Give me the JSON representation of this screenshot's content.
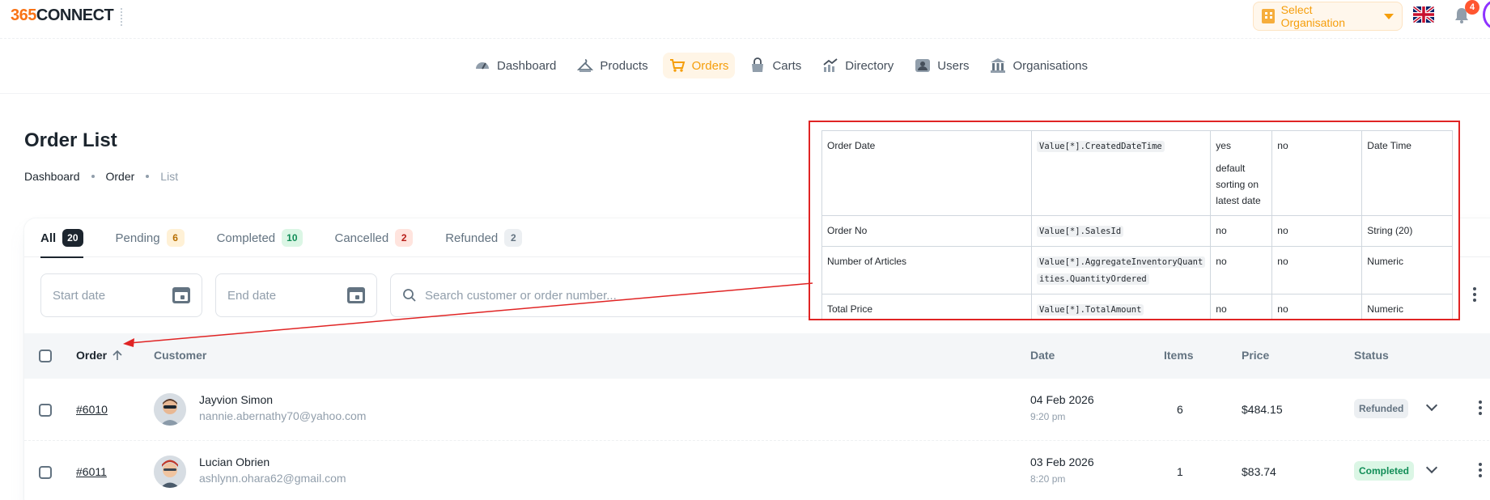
{
  "app": {
    "logo_num": "365",
    "logo_text": "CONNECT"
  },
  "topbar": {
    "select_org_label": "Select Organisation",
    "notifications_count": "4"
  },
  "nav": [
    {
      "label": "Dashboard",
      "icon": "dashboard-icon"
    },
    {
      "label": "Products",
      "icon": "products-icon"
    },
    {
      "label": "Orders",
      "icon": "orders-icon",
      "active": true
    },
    {
      "label": "Carts",
      "icon": "cart-icon"
    },
    {
      "label": "Directory",
      "icon": "directory-icon"
    },
    {
      "label": "Users",
      "icon": "users-icon"
    },
    {
      "label": "Organisations",
      "icon": "organisations-icon"
    }
  ],
  "page": {
    "title": "Order List",
    "breadcrumb": [
      "Dashboard",
      "Order",
      "List"
    ]
  },
  "tabs": [
    {
      "label": "All",
      "count": "20"
    },
    {
      "label": "Pending",
      "count": "6"
    },
    {
      "label": "Completed",
      "count": "10"
    },
    {
      "label": "Cancelled",
      "count": "2"
    },
    {
      "label": "Refunded",
      "count": "2"
    }
  ],
  "filters": {
    "start_date_placeholder": "Start date",
    "end_date_placeholder": "End date",
    "search_placeholder": "Search customer or order number..."
  },
  "table": {
    "headers": {
      "order": "Order",
      "customer": "Customer",
      "date": "Date",
      "items": "Items",
      "price": "Price",
      "status": "Status"
    },
    "rows": [
      {
        "order": "#6010",
        "name": "Jayvion Simon",
        "email": "nannie.abernathy70@yahoo.com",
        "date": "04 Feb 2026",
        "time": "9:20 pm",
        "items": "6",
        "price": "$484.15",
        "status": "Refunded"
      },
      {
        "order": "#6011",
        "name": "Lucian Obrien",
        "email": "ashlynn.ohara62@gmail.com",
        "date": "03 Feb 2026",
        "time": "8:20 pm",
        "items": "1",
        "price": "$83.74",
        "status": "Completed"
      }
    ]
  },
  "spec": {
    "rows": [
      {
        "field": "Order Date",
        "path": "Value[*].CreatedDateTime",
        "c1": "yes",
        "c1_note": "default sorting on latest date",
        "c2": "no",
        "type": "Date Time"
      },
      {
        "field": "Order No",
        "path": "Value[*].SalesId",
        "c1": "no",
        "c1_note": "",
        "c2": "no",
        "type": "String (20)"
      },
      {
        "field": "Number of Articles",
        "path_a": "Value[*].AggregateInventoryQuant",
        "path_b": "ities.QuantityOrdered",
        "c1": "no",
        "c1_note": "",
        "c2": "no",
        "type": "Numeric"
      },
      {
        "field": "Total Price",
        "path": "Value[*].TotalAmount",
        "c1": "no",
        "c1_note": "",
        "c2": "no",
        "type": "Numeric"
      }
    ]
  },
  "colors": {
    "accent": "#f59e0b",
    "annotation_red": "#e02424"
  }
}
